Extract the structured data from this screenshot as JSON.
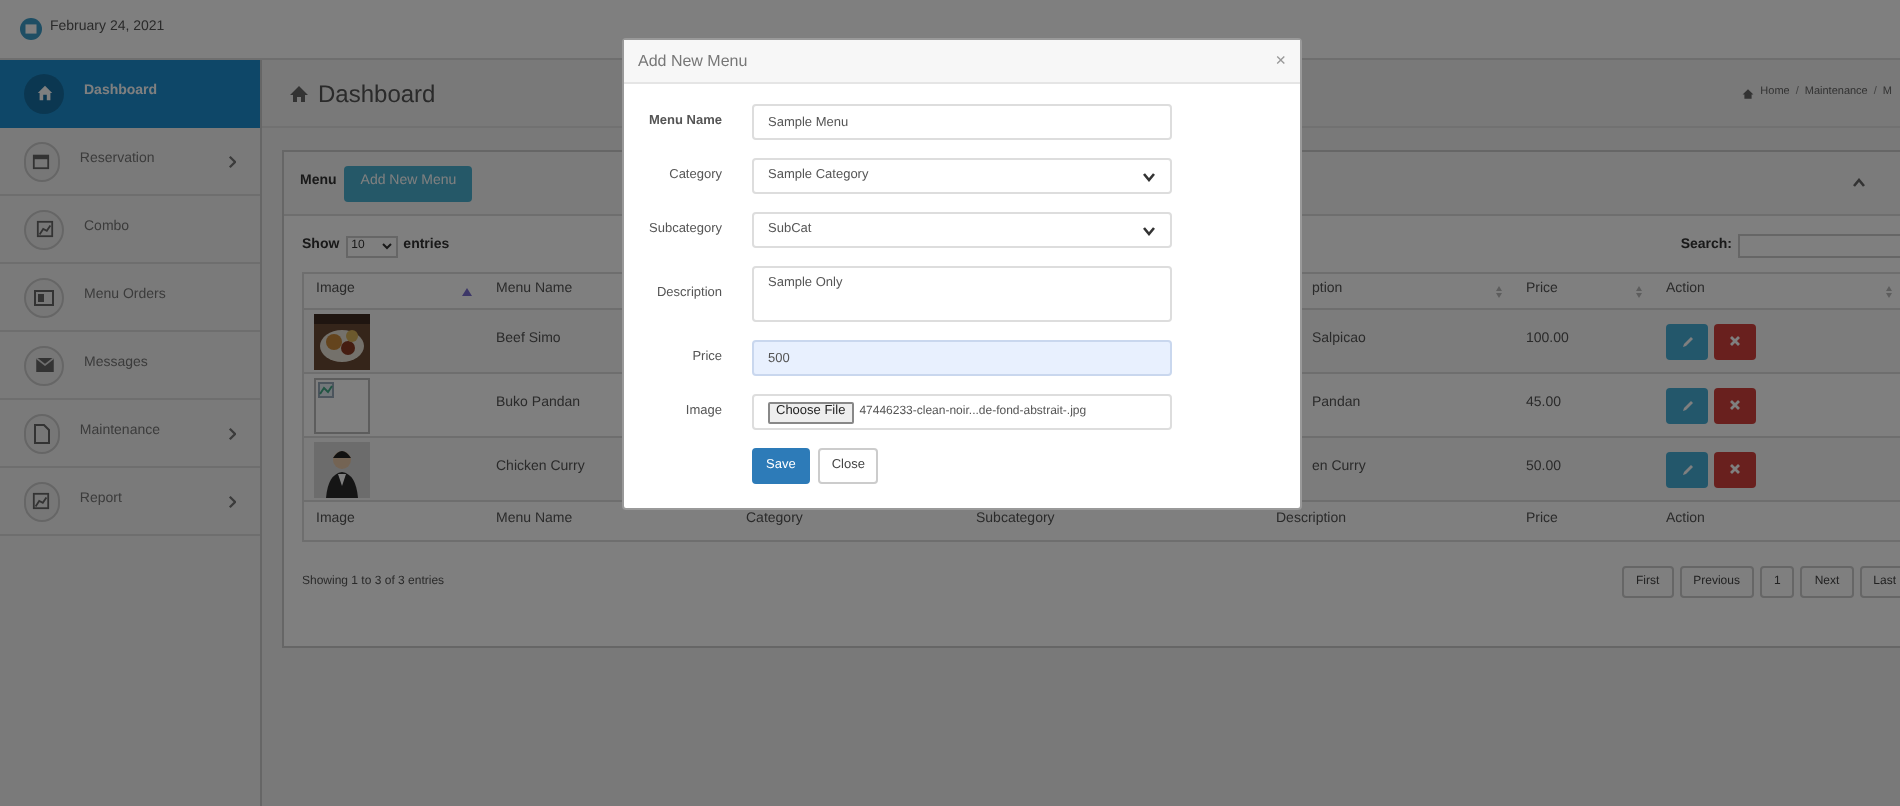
{
  "header": {
    "date": "February 24, 2021"
  },
  "sidebar": {
    "items": [
      {
        "label": "Dashboard",
        "selected": true,
        "expandable": false
      },
      {
        "label": "Reservation",
        "selected": false,
        "expandable": true
      },
      {
        "label": "Combo",
        "selected": false,
        "expandable": false
      },
      {
        "label": "Menu Orders",
        "selected": false,
        "expandable": false
      },
      {
        "label": "Messages",
        "selected": false,
        "expandable": false
      },
      {
        "label": "Maintenance",
        "selected": false,
        "expandable": true
      },
      {
        "label": "Report",
        "selected": false,
        "expandable": true
      }
    ]
  },
  "page": {
    "title": "Dashboard",
    "breadcrumb": {
      "separator": "/",
      "items": [
        "Home",
        "Maintenance",
        "M"
      ]
    }
  },
  "panel": {
    "title": "Menu",
    "add_button": "Add New Menu",
    "show_label": "Show",
    "page_size": "10",
    "entries_label": "entries",
    "search_label": "Search:",
    "table": {
      "header": [
        {
          "text": "Image",
          "sorted": true
        },
        {
          "text": "Menu Name",
          "sorted": false
        },
        {
          "text": "ption",
          "sorted": false
        },
        {
          "text": "Price",
          "sorted": false
        },
        {
          "text": "Action",
          "sorted": false
        }
      ],
      "rows": [
        {
          "kind": "picture",
          "menu_name": "Beef Simo",
          "description": "Salpicao",
          "price": "100.00"
        },
        {
          "kind": "broken",
          "menu_name": "Buko Pandan",
          "description": "Pandan",
          "price": "45.00"
        },
        {
          "kind": "picture",
          "menu_name": "Chicken Curry",
          "description": "en Curry",
          "price": "50.00"
        }
      ],
      "footer": [
        "Image",
        "Menu Name",
        "Category",
        "Subcategory",
        "Description",
        "Price",
        "Action"
      ]
    },
    "info": "Showing 1 to 3 of 3 entries",
    "pagination": [
      "First",
      "Previous",
      "1",
      "Next",
      "Last"
    ]
  },
  "modal": {
    "title": "Add New Menu",
    "close_glyph": "×",
    "fields": [
      {
        "label": "Menu Name",
        "kind": "text",
        "value": "Sample Menu",
        "focused": false
      },
      {
        "label": "Category",
        "kind": "select",
        "value": "Sample Category",
        "focused": false
      },
      {
        "label": "Subcategory",
        "kind": "select",
        "value": "SubCat",
        "focused": false
      },
      {
        "label": "Description",
        "kind": "textarea",
        "value": "Sample Only",
        "focused": false
      },
      {
        "label": "Price",
        "kind": "text",
        "value": "500",
        "focused": true
      },
      {
        "label": "Image",
        "kind": "file",
        "button": "Choose File",
        "value": "47446233-clean-noir...de-fond-abstrait-.jpg",
        "focused": false
      }
    ],
    "buttons": [
      {
        "label": "Save",
        "kind": "primary"
      },
      {
        "label": "Close",
        "kind": "default"
      }
    ]
  }
}
